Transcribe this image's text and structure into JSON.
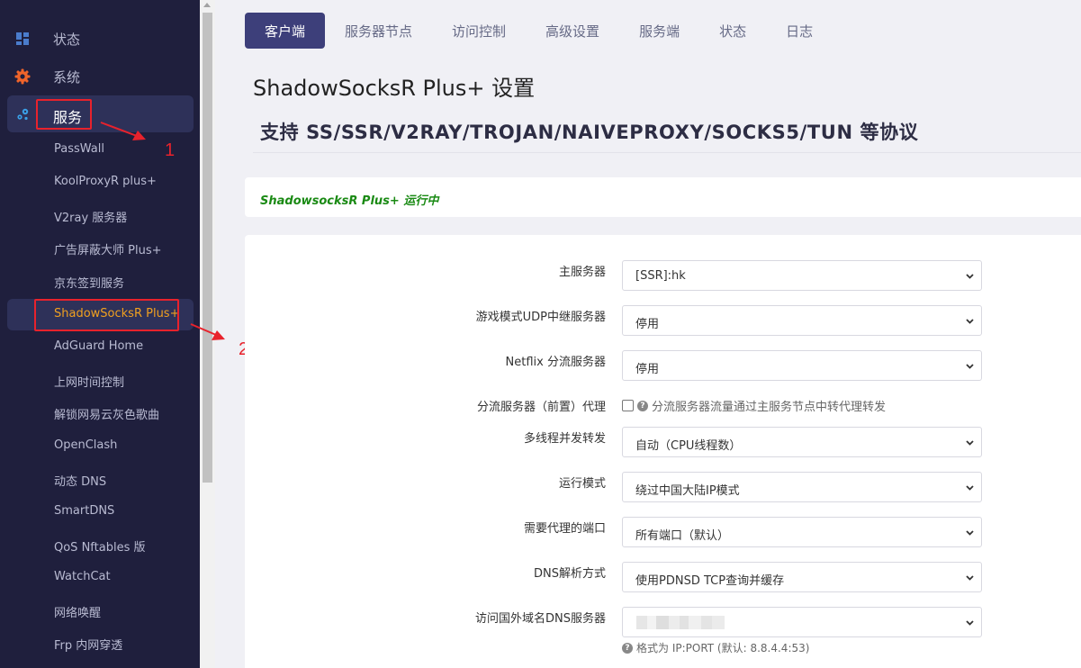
{
  "sidebar": {
    "top_items": [
      {
        "label": "状态",
        "icon": "dashboard-icon"
      },
      {
        "label": "系统",
        "icon": "gear-icon"
      },
      {
        "label": "服务",
        "icon": "services-icon"
      }
    ],
    "sub_items": [
      {
        "label": "PassWall"
      },
      {
        "label": "KoolProxyR plus+"
      },
      {
        "label": "V2ray 服务器"
      },
      {
        "label": "广告屏蔽大师 Plus+"
      },
      {
        "label": "京东签到服务"
      },
      {
        "label": "ShadowSocksR Plus+"
      },
      {
        "label": "AdGuard Home"
      },
      {
        "label": "上网时间控制"
      },
      {
        "label": "解锁网易云灰色歌曲"
      },
      {
        "label": "OpenClash"
      },
      {
        "label": "动态 DNS"
      },
      {
        "label": "SmartDNS"
      },
      {
        "label": "QoS Nftables 版"
      },
      {
        "label": "WatchCat"
      },
      {
        "label": "网络唤醒"
      },
      {
        "label": "Frp 内网穿透"
      }
    ]
  },
  "annotations": {
    "step1": "1",
    "step2": "2"
  },
  "tabs": [
    {
      "label": "客户端"
    },
    {
      "label": "服务器节点"
    },
    {
      "label": "访问控制"
    },
    {
      "label": "高级设置"
    },
    {
      "label": "服务端"
    },
    {
      "label": "状态"
    },
    {
      "label": "日志"
    }
  ],
  "page": {
    "title": "ShadowSocksR Plus+ 设置",
    "subtitle": "支持 SS/SSR/V2RAY/TROJAN/NAIVEPROXY/SOCKS5/TUN 等协议",
    "status": "ShadowsocksR Plus+ 运行中"
  },
  "form": {
    "main_server": {
      "label": "主服务器",
      "value": "[SSR]:hk"
    },
    "udp_relay": {
      "label": "游戏模式UDP中继服务器",
      "value": "停用"
    },
    "netflix": {
      "label": "Netflix 分流服务器",
      "value": "停用"
    },
    "pre_proxy": {
      "label": "分流服务器（前置）代理",
      "help_text": "分流服务器流量通过主服务节点中转代理转发",
      "checked": false
    },
    "threads": {
      "label": "多线程并发转发",
      "value": "自动（CPU线程数）"
    },
    "run_mode": {
      "label": "运行模式",
      "value": "绕过中国大陆IP模式"
    },
    "ports": {
      "label": "需要代理的端口",
      "value": "所有端口（默认）"
    },
    "dns_mode": {
      "label": "DNS解析方式",
      "value": "使用PDNSD TCP查询并缓存"
    },
    "foreign_dns": {
      "label": "访问国外域名DNS服务器",
      "hint": "格式为 IP:PORT (默认: 8.8.4.4:53)"
    }
  },
  "colors": {
    "sidebar_bg": "#1f1f3d",
    "active_tab": "#3d3f7a",
    "highlight_text": "#f0a020",
    "status_green": "#1a8a14",
    "annotation_red": "#e8222c"
  }
}
